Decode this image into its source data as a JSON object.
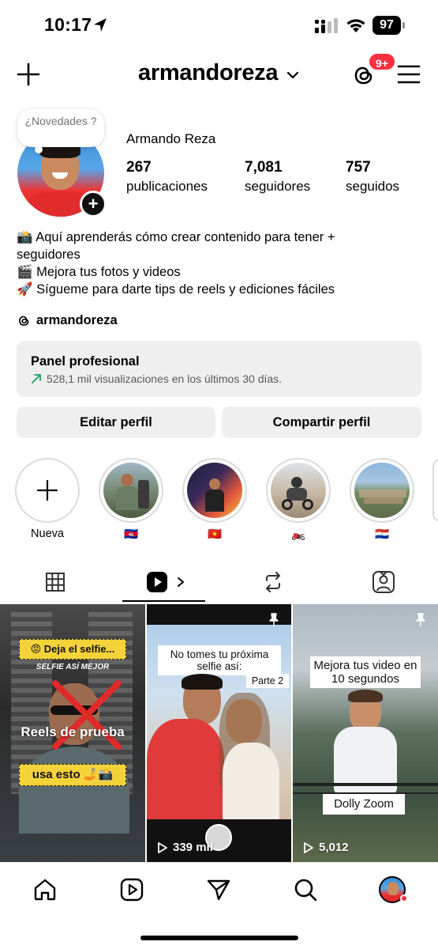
{
  "status_bar": {
    "time": "10:17",
    "battery": "97"
  },
  "header": {
    "username": "armandoreza",
    "notification_badge": "9+"
  },
  "profile": {
    "note": "¿Novedades ?",
    "display_name": "Armando Reza",
    "stats": [
      {
        "value": "267",
        "label": "publicaciones"
      },
      {
        "value": "7,081",
        "label": "seguidores"
      },
      {
        "value": "757",
        "label": "seguidos"
      }
    ],
    "bio": [
      "📸 Aquí aprenderás cómo crear contenido para tener +",
      "seguidores",
      "🎬 Mejora tus fotos y videos",
      "🚀 Sígueme para darte tips de reels y ediciones fáciles"
    ],
    "threads_handle": "armandoreza"
  },
  "pro_panel": {
    "title": "Panel profesional",
    "subtitle": "528,1 mil visualizaciones en los últimos 30 días."
  },
  "buttons": {
    "edit": "Editar perfil",
    "share": "Compartir perfil"
  },
  "highlights": [
    {
      "label": "Nueva"
    },
    {
      "label": "🇰🇭"
    },
    {
      "label": "🇻🇳"
    },
    {
      "label": "🏍️"
    },
    {
      "label": "🇵🇾"
    }
  ],
  "grid": [
    {
      "caption_top": "😡 Deja el selfie...",
      "caption_sub": "SELFIE ASÍ MEJOR",
      "caption_mid": "Reels de prueba",
      "caption_bottom": "usa esto 🤳📸"
    },
    {
      "caption_top": "No tomes tu próxima selfie así:",
      "caption_part": "Parte 2",
      "views": "339 mil"
    },
    {
      "caption_top": "Mejora tus video en 10 segundos",
      "caption_bottom": "Dolly Zoom",
      "views": "5,012"
    }
  ],
  "colors": {
    "accent": "#ff3040",
    "panel_bg": "#efefef",
    "trend_green": "#1aa163"
  }
}
